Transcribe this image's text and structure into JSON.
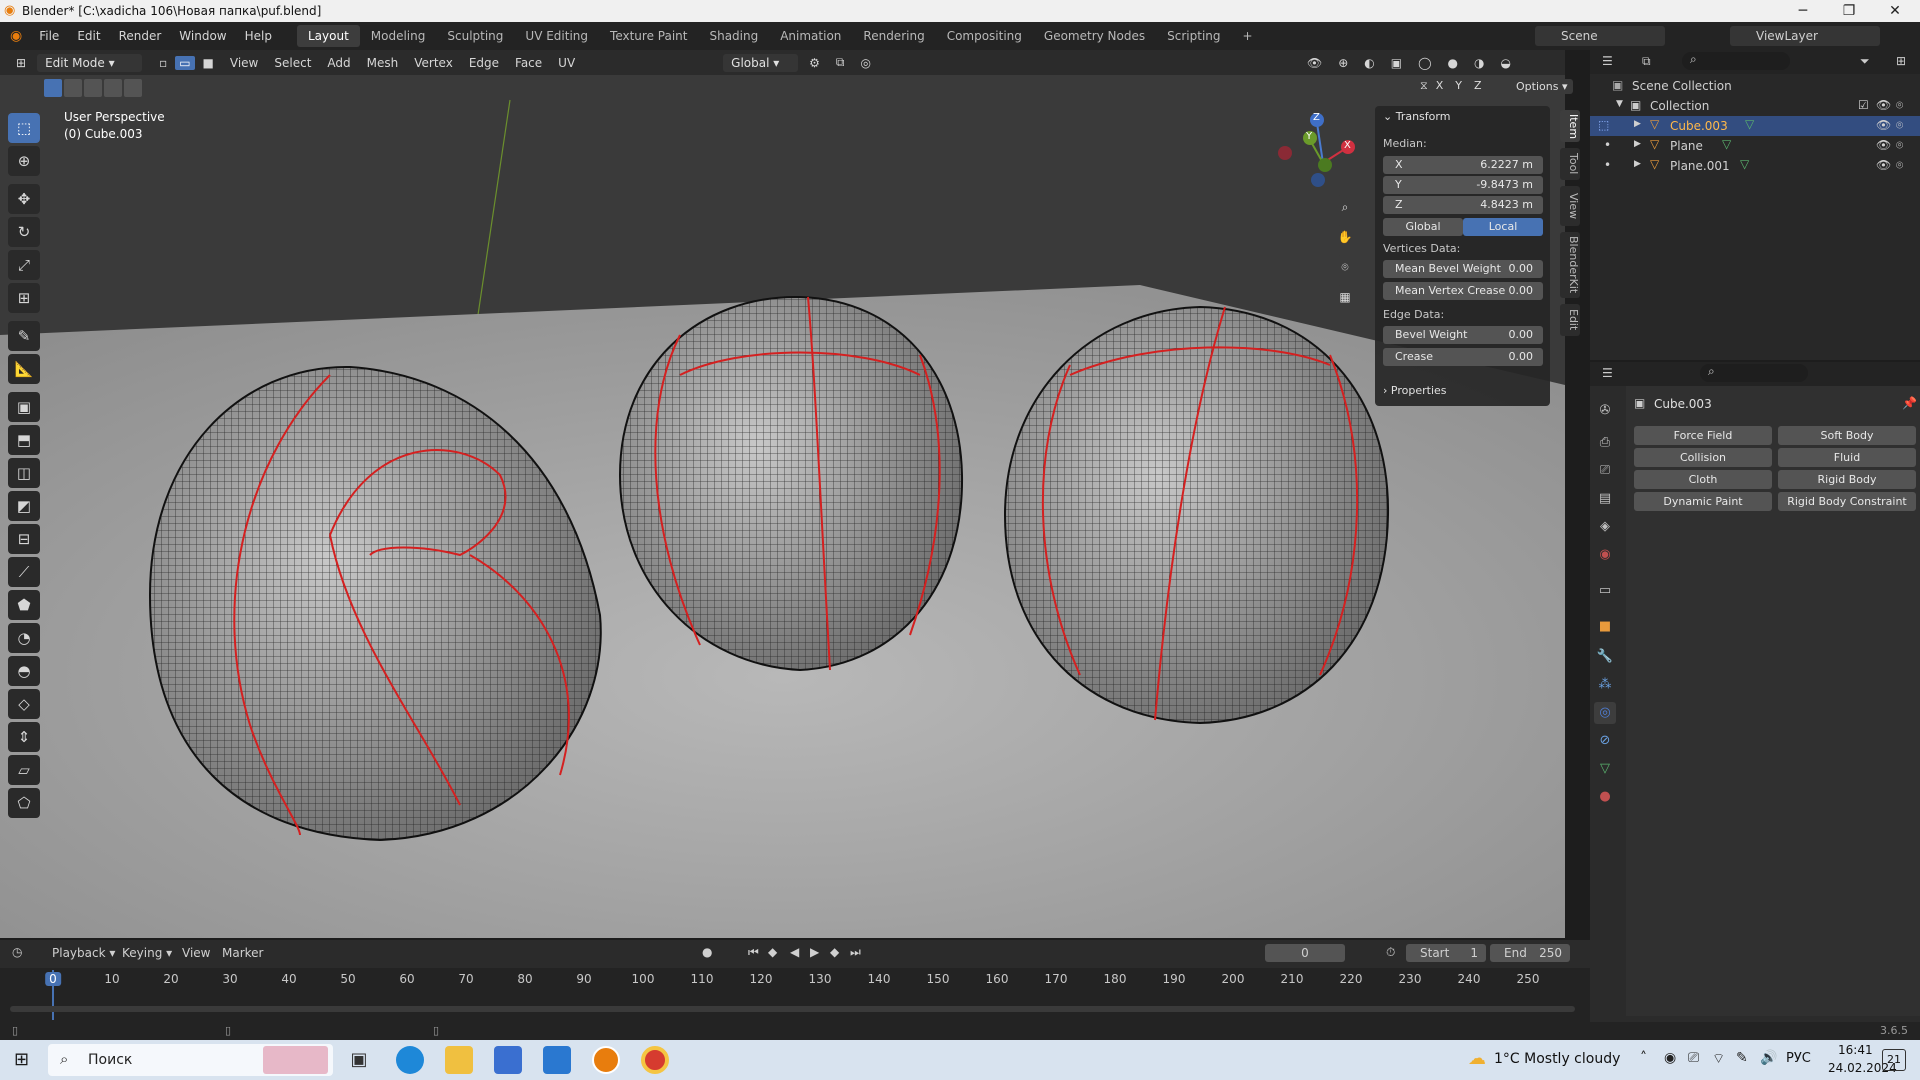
{
  "window": {
    "title": "Blender* [C:\\xadicha 106\\Новая папка\\puf.blend]",
    "minimize": "─",
    "maximize": "❐",
    "close": "✕"
  },
  "menu": [
    "File",
    "Edit",
    "Render",
    "Window",
    "Help"
  ],
  "workspaces": [
    "Layout",
    "Modeling",
    "Sculpting",
    "UV Editing",
    "Texture Paint",
    "Shading",
    "Animation",
    "Rendering",
    "Compositing",
    "Geometry Nodes",
    "Scripting",
    "+"
  ],
  "active_workspace": "Layout",
  "scene": {
    "label": "Scene",
    "viewlayer": "ViewLayer"
  },
  "header": {
    "mode": "Edit Mode",
    "items": [
      "View",
      "Select",
      "Add",
      "Mesh",
      "Vertex",
      "Edge",
      "Face",
      "UV"
    ],
    "orientation": "Global",
    "options": "Options",
    "axes": [
      "X",
      "Y",
      "Z"
    ]
  },
  "viewport": {
    "overlay_line1": "User Perspective",
    "overlay_line2": "(0) Cube.003",
    "gizmo_axes": [
      "Z",
      "Y",
      "X"
    ]
  },
  "npanel": {
    "section": "Transform",
    "median_label": "Median:",
    "x_label": "X",
    "x_value": "6.2227 m",
    "y_label": "Y",
    "y_value": "-9.8473 m",
    "z_label": "Z",
    "z_value": "4.8423 m",
    "global": "Global",
    "local": "Local",
    "vertices_data": "Vertices Data:",
    "mean_bevel_weight": "Mean Bevel Weight",
    "mean_bevel_weight_value": "0.00",
    "mean_vertex_crease": "Mean Vertex Crease",
    "mean_vertex_crease_value": "0.00",
    "edge_data": "Edge Data:",
    "bevel_weight": "Bevel Weight",
    "bevel_weight_value": "0.00",
    "crease": "Crease",
    "crease_value": "0.00",
    "properties": "Properties",
    "tabs": [
      "Item",
      "Tool",
      "View",
      "BlenderKit",
      "Edit"
    ]
  },
  "outliner": {
    "scene_collection": "Scene Collection",
    "collection": "Collection",
    "items": [
      "Cube.003",
      "Plane",
      "Plane.001"
    ]
  },
  "properties": {
    "object": "Cube.003",
    "buttons": [
      [
        "Force Field",
        "Soft Body"
      ],
      [
        "Collision",
        "Fluid"
      ],
      [
        "Cloth",
        "Rigid Body"
      ],
      [
        "Dynamic Paint",
        "Rigid Body Constraint"
      ]
    ]
  },
  "timeline": {
    "menu": [
      "Playback",
      "Keying",
      "View",
      "Marker"
    ],
    "current_frame": "0",
    "start_label": "Start",
    "start": "1",
    "end_label": "End",
    "end": "250",
    "ticks": [
      "0",
      "10",
      "20",
      "30",
      "40",
      "50",
      "60",
      "70",
      "80",
      "90",
      "100",
      "110",
      "120",
      "130",
      "140",
      "150",
      "160",
      "170",
      "180",
      "190",
      "200",
      "210",
      "220",
      "230",
      "240",
      "250"
    ]
  },
  "status": {
    "version": "3.6.5"
  },
  "taskbar": {
    "search": "Поиск",
    "weather": "1°C  Mostly cloudy",
    "lang": "РУС",
    "time": "16:41",
    "date": "24.02.2024",
    "notif": "21"
  }
}
